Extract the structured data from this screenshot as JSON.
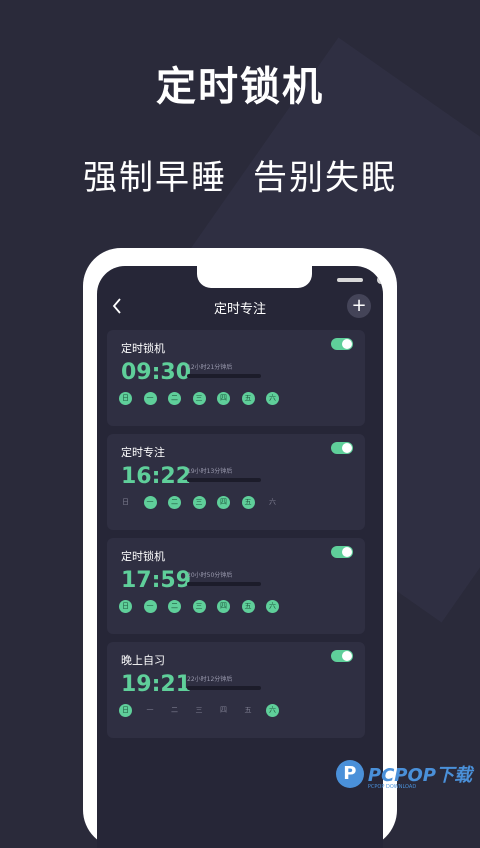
{
  "hero": {
    "title": "定时锁机",
    "subtitle_left": "强制早睡",
    "subtitle_right": "告别失眠"
  },
  "app": {
    "back_icon": "chevron-left-icon",
    "header_title": "定时专注",
    "add_icon": "plus-icon"
  },
  "colors": {
    "accent": "#5fcf9a",
    "background": "#2a2a3a",
    "card": "#2f2f42"
  },
  "cards": [
    {
      "title": "定时锁机",
      "time": "09:30",
      "remain": "12小时21分钟后",
      "enabled": true,
      "days": [
        {
          "label": "日",
          "on": true
        },
        {
          "label": "一",
          "on": true
        },
        {
          "label": "二",
          "on": true
        },
        {
          "label": "三",
          "on": true
        },
        {
          "label": "四",
          "on": true
        },
        {
          "label": "五",
          "on": true
        },
        {
          "label": "六",
          "on": true
        }
      ]
    },
    {
      "title": "定时专注",
      "time": "16:22",
      "remain": "19小时13分钟后",
      "enabled": true,
      "days": [
        {
          "label": "日",
          "on": false
        },
        {
          "label": "一",
          "on": true
        },
        {
          "label": "二",
          "on": true
        },
        {
          "label": "三",
          "on": true
        },
        {
          "label": "四",
          "on": true
        },
        {
          "label": "五",
          "on": true
        },
        {
          "label": "六",
          "on": false
        }
      ]
    },
    {
      "title": "定时锁机",
      "time": "17:59",
      "remain": "20小时50分钟后",
      "enabled": true,
      "days": [
        {
          "label": "日",
          "on": true
        },
        {
          "label": "一",
          "on": true
        },
        {
          "label": "二",
          "on": true
        },
        {
          "label": "三",
          "on": true
        },
        {
          "label": "四",
          "on": true
        },
        {
          "label": "五",
          "on": true
        },
        {
          "label": "六",
          "on": true
        }
      ]
    },
    {
      "title": "晚上自习",
      "time": "19:21",
      "remain": "22小时12分钟后",
      "enabled": true,
      "days": [
        {
          "label": "日",
          "on": true
        },
        {
          "label": "一",
          "on": false
        },
        {
          "label": "二",
          "on": false
        },
        {
          "label": "三",
          "on": false
        },
        {
          "label": "四",
          "on": false
        },
        {
          "label": "五",
          "on": false
        },
        {
          "label": "六",
          "on": true
        }
      ]
    }
  ],
  "watermark": {
    "logo_letter": "P",
    "text": "PCPOP下载",
    "small": "PCPOP DOWNLOAD"
  }
}
